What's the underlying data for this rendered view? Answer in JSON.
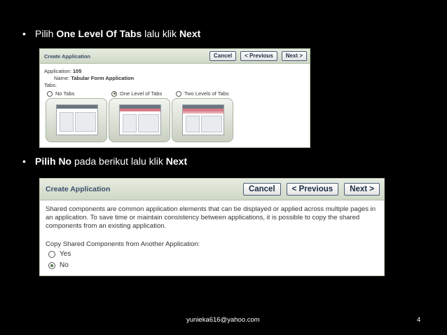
{
  "slide": {
    "bullet1": {
      "prefix": "Pilih ",
      "bold1": "One Level Of Tabs",
      "middle": " lalu klik ",
      "bold2": "Next"
    },
    "bullet2": {
      "bold1": "Pilih No",
      "middle": " pada berikut lalu klik ",
      "bold2": "Next"
    },
    "bullet_symbol": "•",
    "footer_email": "yunieka616@yahoo.com",
    "page_number": "4"
  },
  "panel1": {
    "title": "Create Application",
    "buttons": {
      "cancel": "Cancel",
      "previous": "< Previous",
      "next": "Next >"
    },
    "application_label": "Application:",
    "application_value": "105",
    "name_label": "Name:",
    "name_value": "Tabular Form Application",
    "tabs_label": "Tabs:",
    "options": [
      "No Tabs",
      "One Level of Tabs",
      "Two Levels of Tabs"
    ],
    "selected_index": 1
  },
  "panel2": {
    "title": "Create Application",
    "buttons": {
      "cancel": "Cancel",
      "previous": "< Previous",
      "next": "Next >"
    },
    "description": "Shared components are common application elements that can be displayed or applied across multiple pages in an application. To save time or maintain consistency between applications, it is possible to copy the shared components from an existing application.",
    "question": "Copy Shared Components from Another Application:",
    "options": [
      "Yes",
      "No"
    ],
    "selected_index": 1
  },
  "colors": {
    "background": "#000000",
    "panel_header": "#d8e0cf",
    "title_text": "#3b4d6b",
    "tab_accent": "#d87b87"
  }
}
